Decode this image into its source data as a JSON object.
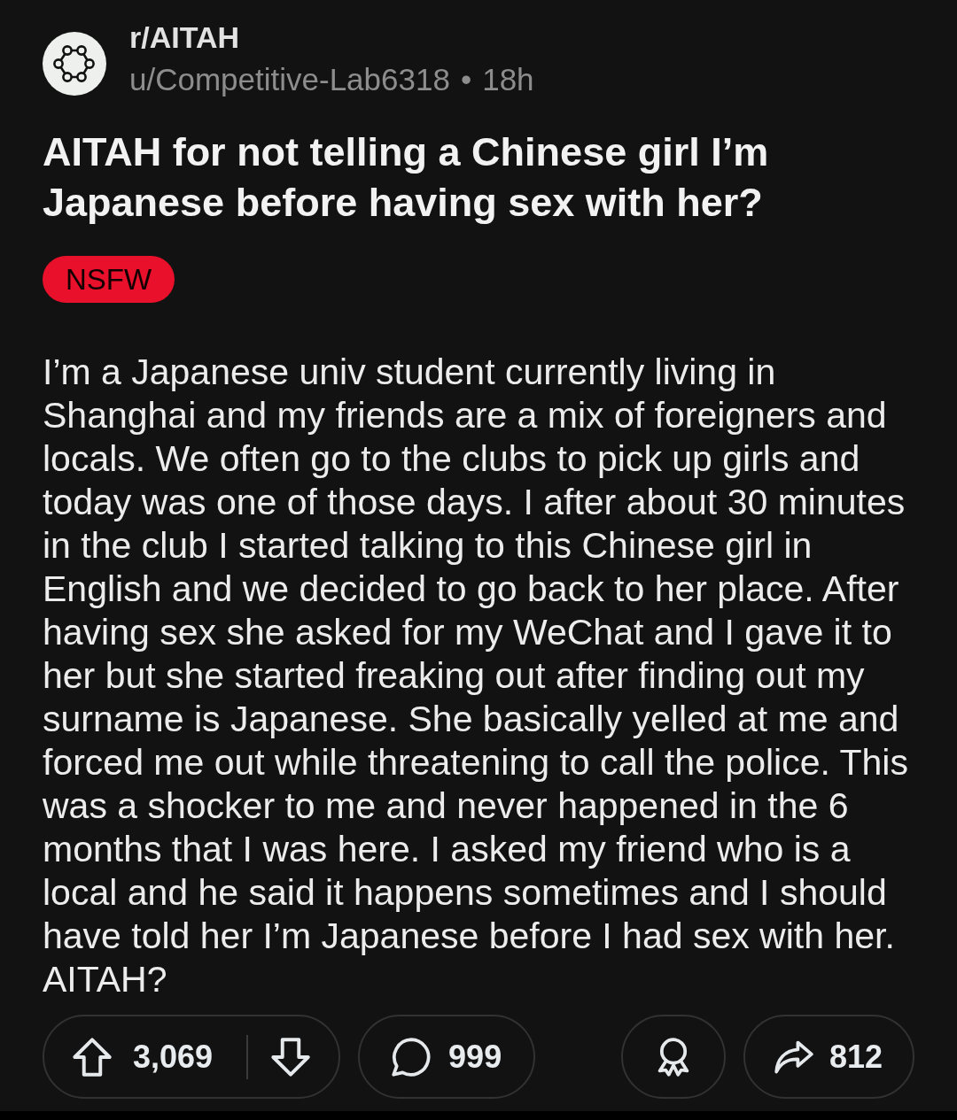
{
  "post": {
    "subreddit": "r/AITAH",
    "author": "u/Competitive-Lab6318",
    "separator": "•",
    "age": "18h",
    "title": "AITAH for not telling a Chinese girl I’m Japanese before having sex with her?",
    "flair": {
      "label": "NSFW",
      "kind": "nsfw"
    },
    "body": "I’m a Japanese univ student currently living in Shanghai and my friends are a mix of foreigners and locals. We often go to the clubs to pick up girls and today was one of those days. I after about 30 minutes in the club I started talking to this Chinese girl in English and we decided to go back to her place. After having sex she asked for my WeChat and I gave it to her but she started freaking out after finding out my surname is Japanese. She basically yelled at me and forced me out while threatening to call the police. This was a shocker to me and never happened in the 6 months that I was here. I asked my friend who is a local and he said it happens sometimes and I should have told her I’m Japanese before I had sex with her. AITAH?"
  },
  "actions": {
    "votes": "3,069",
    "comments": "999",
    "shares": "812"
  }
}
